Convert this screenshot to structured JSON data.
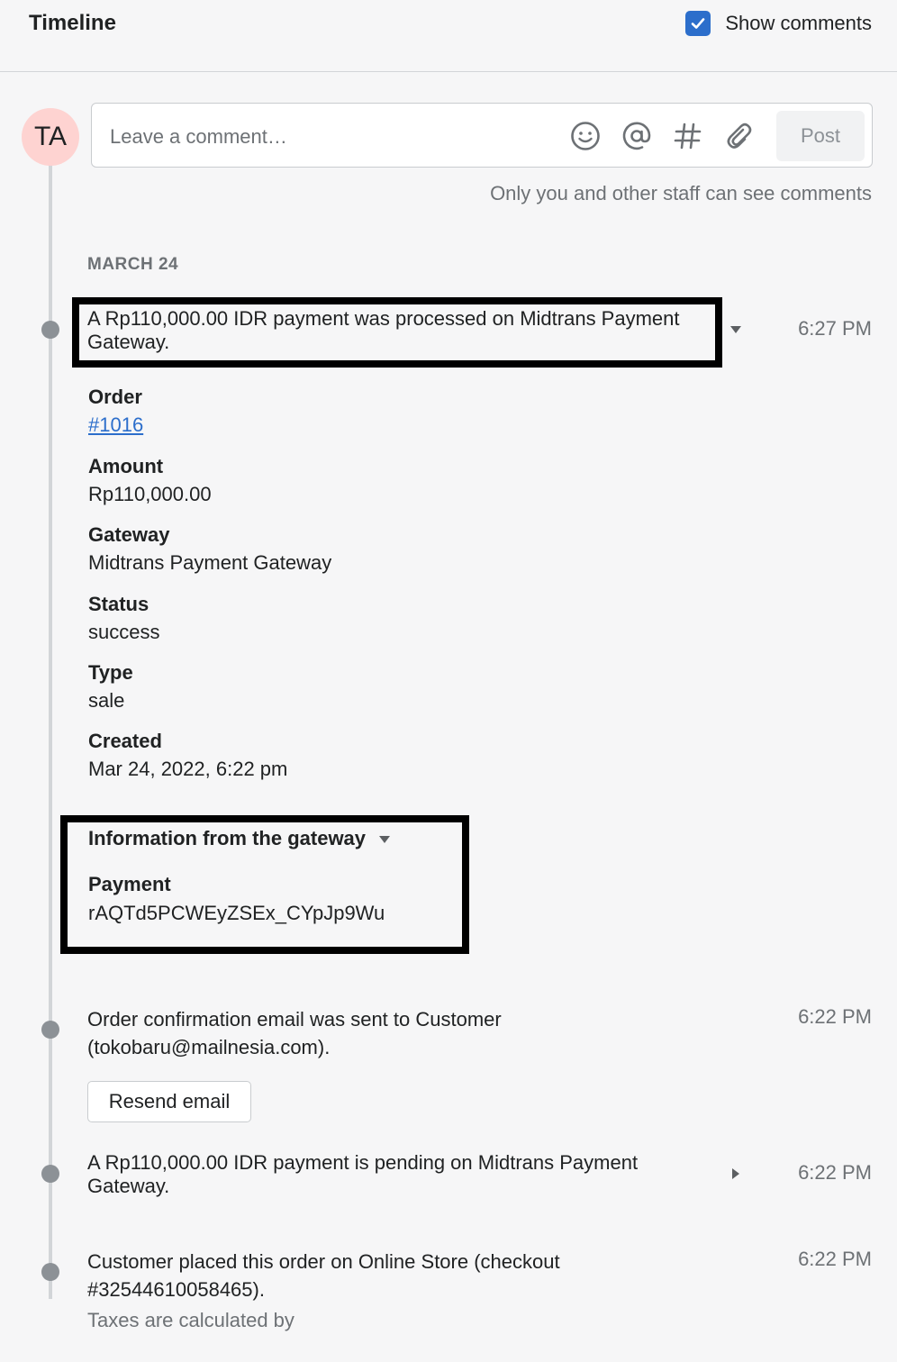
{
  "header": {
    "title": "Timeline",
    "show_comments_label": "Show comments",
    "show_comments_checked": true
  },
  "composer": {
    "avatar_initials": "TA",
    "placeholder": "Leave a comment…",
    "post_label": "Post",
    "icons": [
      "emoji-icon",
      "mention-icon",
      "hashtag-icon",
      "attachment-icon"
    ],
    "staff_note": "Only you and other staff can see comments"
  },
  "date_heading": "MARCH 24",
  "events": [
    {
      "text": "A Rp110,000.00 IDR payment was processed on Midtrans Payment Gateway.",
      "time": "6:27 PM",
      "expanded": true,
      "details": [
        {
          "label": "Order",
          "value": "#1016"
        },
        {
          "label": "Amount",
          "value": "Rp110,000.00"
        },
        {
          "label": "Gateway",
          "value": "Midtrans Payment Gateway"
        },
        {
          "label": "Status",
          "value": "success"
        },
        {
          "label": "Type",
          "value": "sale"
        },
        {
          "label": "Created",
          "value": "Mar 24, 2022, 6:22 pm"
        }
      ],
      "gateway_info": {
        "heading": "Information from the gateway",
        "label": "Payment",
        "value": "rAQTd5PCWEyZSEx_CYpJp9Wu"
      }
    },
    {
      "text_line1": "Order confirmation email was sent to Customer",
      "text_line2": "(tokobaru@mailnesia.com).",
      "time": "6:22 PM",
      "button": "Resend email"
    },
    {
      "text_line1": "A Rp110,000.00 IDR payment is pending on Midtrans Payment",
      "text_line2": "Gateway.",
      "time": "6:22 PM",
      "expanded": false
    },
    {
      "text_line1": "Customer placed this order on Online Store (checkout",
      "text_line2": "#32544610058465).",
      "text_line3": "Taxes are calculated by",
      "time": "6:22 PM"
    }
  ],
  "colors": {
    "accent": "#2c6ecb",
    "background": "#f6f6f7",
    "dot": "#8c9196",
    "avatar_bg": "#fed3d1"
  }
}
